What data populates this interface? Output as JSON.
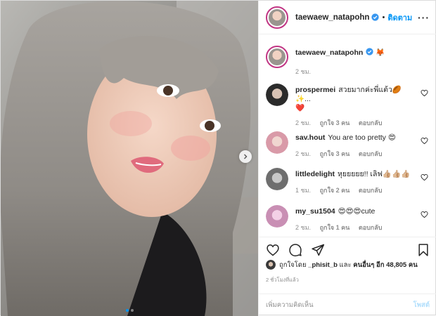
{
  "header": {
    "username": "taewaew_natapohn",
    "separator": "•",
    "follow_label": "ติดตาม",
    "more_label": "···"
  },
  "caption": {
    "username": "taewaew_natapohn",
    "text": "🦊",
    "time": "2 ชม."
  },
  "comments": [
    {
      "username": "prospermei",
      "text": "สวยมากค่ะพี่แต้ว🏉✨...",
      "second_line_emoji": "❤️",
      "time": "2 ชม.",
      "likes": "ถูกใจ 3 คน",
      "reply": "ตอบกลับ"
    },
    {
      "username": "sav.hout",
      "text": "You are too pretty 😍",
      "time": "2 ชม.",
      "likes": "ถูกใจ 3 คน",
      "reply": "ตอบกลับ"
    },
    {
      "username": "littledelight",
      "text": "หุยยยยย!! เลิฟ👍🏼👍🏼👍🏼",
      "time": "1 ชม.",
      "likes": "ถูกใจ 2 คน",
      "reply": "ตอบกลับ"
    },
    {
      "username": "my_su1504",
      "text": "😍😍😍cute",
      "time": "2 ชม.",
      "likes": "ถูกใจ 1 คน",
      "reply": "ตอบกลับ"
    }
  ],
  "likes": {
    "prefix": "ถูกใจโดย",
    "user": "_phisit_b",
    "middle": "และ",
    "others": "คนอื่นๆ อีก 48,805 คน"
  },
  "posted_time": "2 ชั่วโมงที่แล้ว",
  "add_comment": {
    "placeholder": "เพิ่มความคิดเห็น",
    "post_label": "โพสต์"
  },
  "icons": {
    "verified": "verified-badge-icon",
    "heart": "heart-icon",
    "comment": "comment-icon",
    "share": "paper-plane-icon",
    "save": "bookmark-icon",
    "next": "chevron-right-icon"
  },
  "colors": {
    "accent": "#0095f6",
    "muted": "#8e8e8e",
    "post_disabled": "#b2dffc"
  },
  "carousel": {
    "count": 2,
    "active": 0
  }
}
